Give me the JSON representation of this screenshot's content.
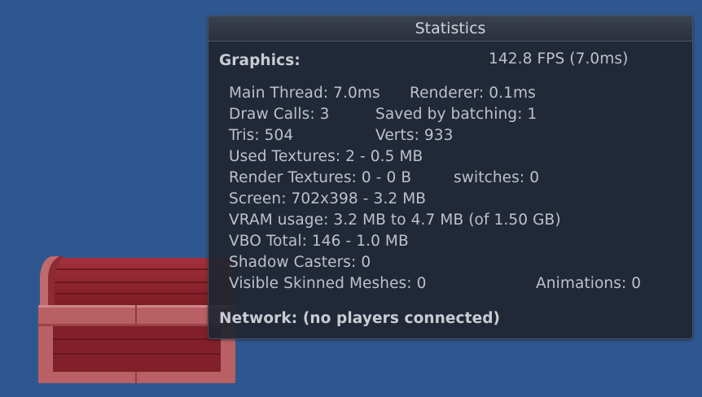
{
  "window": {
    "title": "Statistics"
  },
  "graphics": {
    "heading": "Graphics:",
    "fps": "142.8 FPS (7.0ms)",
    "main_thread": "Main Thread: 7.0ms",
    "renderer": "Renderer: 0.1ms",
    "draw_calls": "Draw Calls: 3",
    "saved_by_batching": "Saved by batching: 1",
    "tris": "Tris: 504",
    "verts": "Verts: 933",
    "used_textures": "Used Textures: 2 - 0.5 MB",
    "render_textures": "Render Textures: 0 - 0 B",
    "switches": "switches: 0",
    "screen": "Screen: 702x398 - 3.2 MB",
    "vram_usage": "VRAM usage: 3.2 MB to 4.7 MB (of 1.50 GB)",
    "vbo_total": "VBO Total: 146 - 1.0 MB",
    "shadow_casters": "Shadow Casters: 0",
    "visible_skinned_meshes": "Visible Skinned Meshes: 0",
    "animations": "Animations: 0"
  },
  "network": {
    "status": "Network: (no players connected)"
  },
  "colors": {
    "viewport_background": "#2f578f",
    "panel_background": "#202632",
    "text": "#bdc1c8",
    "chest_wood": "#8a2126"
  },
  "scene": {
    "object_icon": "treasure-chest-icon"
  }
}
